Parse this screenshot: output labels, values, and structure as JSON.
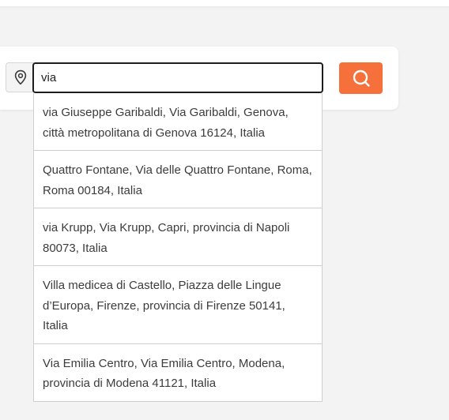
{
  "search": {
    "value": "via",
    "suggestions": [
      "via Giuseppe Garibaldi, Via Garibaldi, Genova, città metropolitana di Genova 16124, Italia",
      "Quattro Fontane, Via delle Quattro Fontane, Roma, Roma 00184, Italia",
      "via Krupp, Via Krupp, Capri, provincia di Napoli 80073, Italia",
      "Villa medicea di Castello, Piazza delle Lingue d’Europa, Firenze, provincia di Firenze 50141, Italia",
      "Via Emilia Centro, Via Emilia Centro, Modena, provincia di Modena 41121, Italia"
    ]
  },
  "icons": {
    "location": "map-pin-icon",
    "search": "search-icon"
  },
  "colors": {
    "accent": "#f5703a",
    "input_border": "#1d1d1d",
    "background": "#f3f3f3"
  }
}
